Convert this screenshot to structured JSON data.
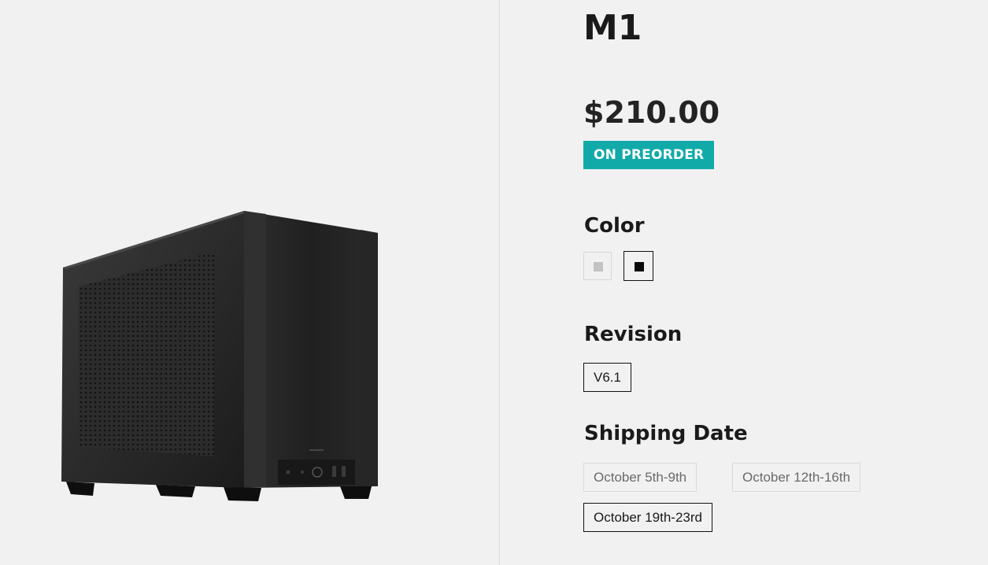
{
  "product": {
    "title": "M1",
    "price": "$210.00",
    "badge": "ON PREORDER",
    "image_name": "pc-case-image"
  },
  "colors": {
    "accent_badge": "#11aaa9",
    "case_black": "#2a2a2a"
  },
  "color_section": {
    "label": "Color",
    "options": [
      {
        "name": "silver",
        "swatch": "#c3c3c3",
        "selected": false
      },
      {
        "name": "black",
        "swatch": "#0a0a0a",
        "selected": true
      }
    ]
  },
  "revision_section": {
    "label": "Revision",
    "options": [
      {
        "label": "V6.1",
        "selected": true
      }
    ]
  },
  "shipping_section": {
    "label": "Shipping Date",
    "options": [
      {
        "label": "October 5th-9th",
        "selected": false
      },
      {
        "label": "October 12th-16th",
        "selected": false
      },
      {
        "label": "October 19th-23rd",
        "selected": true
      }
    ]
  }
}
